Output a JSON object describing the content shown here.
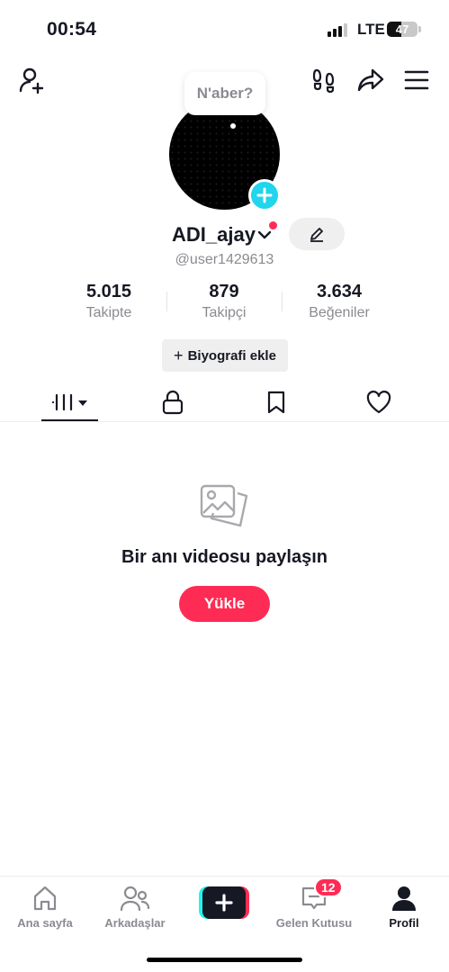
{
  "status_bar": {
    "time": "00:54",
    "network": "LTE",
    "battery": "47",
    "signal_bars_filled": 3,
    "signal_bars_total": 4
  },
  "top_nav": {
    "icons": [
      "add-friend-icon",
      "footprint-icon",
      "share-icon",
      "menu-icon"
    ]
  },
  "profile": {
    "status_bubble": "N'aber?",
    "display_name": "ADI_ajay",
    "username": "@user1429613",
    "stats": [
      {
        "value": "5.015",
        "label": "Takipte"
      },
      {
        "value": "879",
        "label": "Takipçi"
      },
      {
        "value": "3.634",
        "label": "Beğeniler"
      }
    ],
    "bio_button": "Biyografi ekle",
    "bio_button_icon": "+"
  },
  "tabs": {
    "active": "videos",
    "items": [
      "videos-grid-icon",
      "lock-icon",
      "bookmark-icon",
      "heart-icon"
    ]
  },
  "empty_state": {
    "title": "Bir anı videosu paylaşın",
    "button": "Yükle"
  },
  "bottom_nav": {
    "items": [
      {
        "label": "Ana sayfa",
        "icon": "home-icon"
      },
      {
        "label": "Arkadaşlar",
        "icon": "friends-icon"
      },
      {
        "label": "",
        "icon": "create-icon"
      },
      {
        "label": "Gelen Kutusu",
        "icon": "inbox-icon",
        "badge": "12"
      },
      {
        "label": "Profil",
        "icon": "profile-icon"
      }
    ]
  },
  "colors": {
    "accent": "#fe2c55",
    "cyan": "#20d5ec",
    "text": "#161823",
    "muted": "#8a8b91"
  }
}
